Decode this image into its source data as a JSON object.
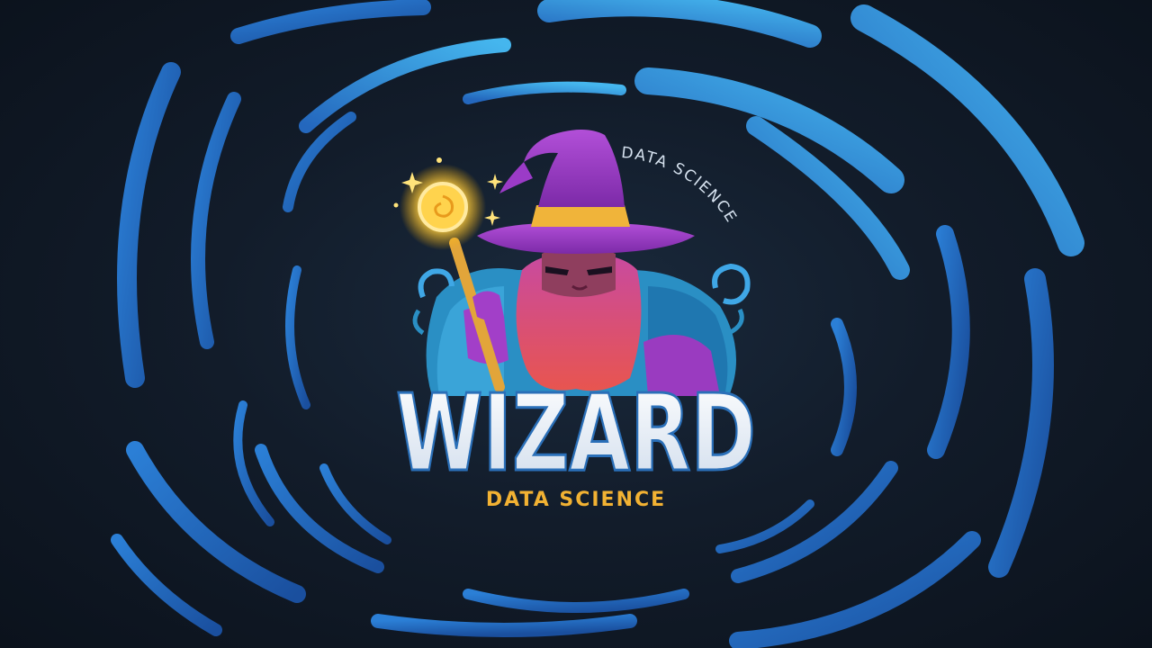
{
  "logo": {
    "title": "WIZARD",
    "tagline": "DATA SCIENCE",
    "arc_text": "DATA SCIENCE"
  },
  "colors": {
    "background": "#121c2a",
    "swirl_dark": "#1f5fb0",
    "swirl_light": "#3fa7e6",
    "hat": "#9b3bc7",
    "hat_band": "#f0b43a",
    "beard": "#d2457a",
    "robe": "#2a8fc4",
    "orb": "#ffd34d",
    "title": "#e9eef6",
    "tagline": "#f2b233"
  },
  "icons": {
    "character": "wizard-icon",
    "staff": "magic-staff-icon",
    "sparkle": "sparkle-icon"
  }
}
